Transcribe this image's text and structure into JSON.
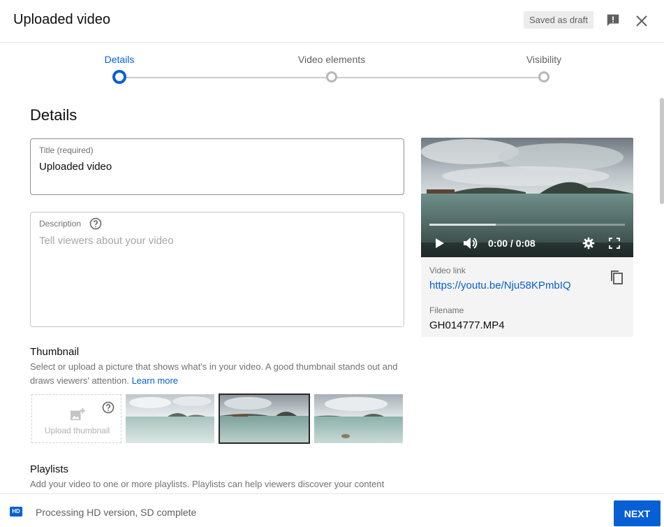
{
  "header": {
    "title": "Uploaded video",
    "draft_badge": "Saved as draft"
  },
  "stepper": {
    "steps": [
      {
        "label": "Details",
        "active": true
      },
      {
        "label": "Video elements",
        "active": false
      },
      {
        "label": "Visibility",
        "active": false
      }
    ]
  },
  "details": {
    "heading": "Details",
    "title_field": {
      "label": "Title (required)",
      "value": "Uploaded video"
    },
    "description_field": {
      "label": "Description",
      "placeholder": "Tell viewers about your video"
    }
  },
  "thumbnail": {
    "heading": "Thumbnail",
    "description": "Select or upload a picture that shows what's in your video. A good thumbnail stands out and draws viewers' attention.",
    "learn_more": "Learn more",
    "upload_label": "Upload thumbnail",
    "selected_index": 1
  },
  "playlists": {
    "heading": "Playlists",
    "description": "Add your video to one or more playlists. Playlists can help viewers discover your content"
  },
  "video": {
    "time": "0:00 / 0:08",
    "buffered_fraction": 0.34,
    "link_label": "Video link",
    "link": "https://youtu.be/Nju58KPmbIQ",
    "filename_label": "Filename",
    "filename": "GH014777.MP4"
  },
  "footer": {
    "status": "Processing HD version, SD complete",
    "hd_badge": "HD",
    "next_label": "NEXT"
  },
  "colors": {
    "accent": "#065fd4",
    "text": "#0d0d0d",
    "muted": "#717171"
  }
}
